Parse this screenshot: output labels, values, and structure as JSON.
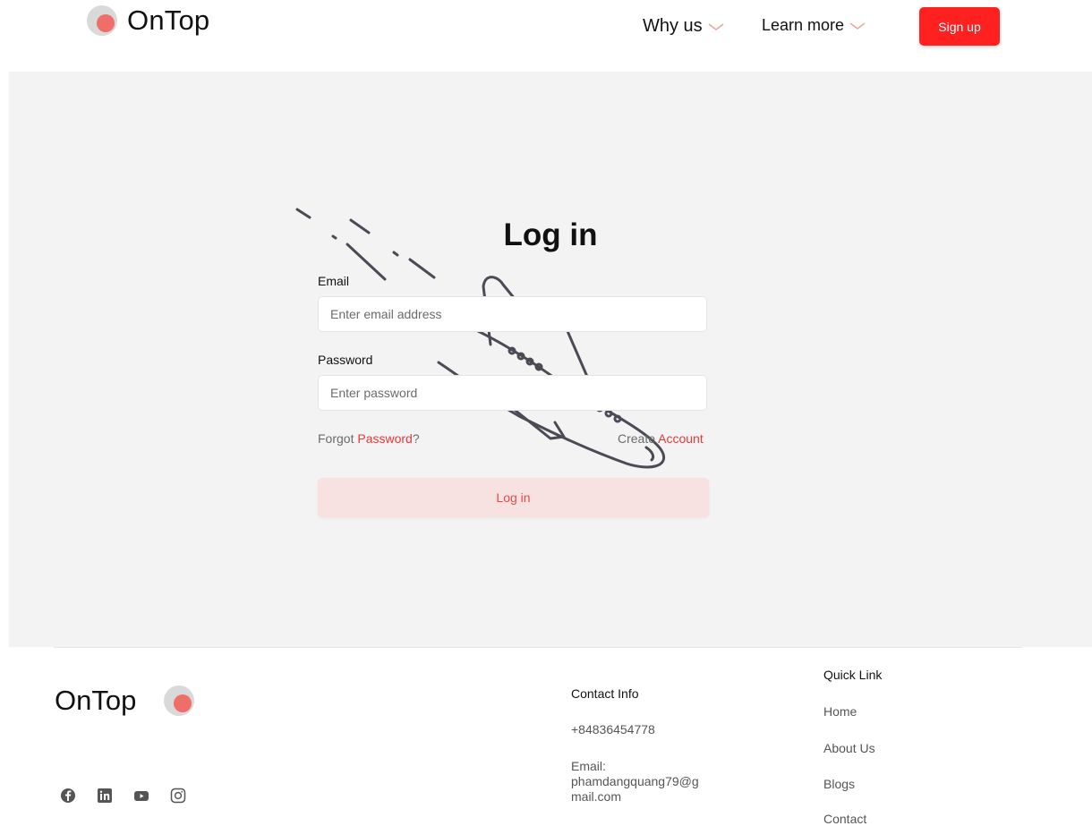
{
  "header": {
    "brand": "OnTop",
    "nav": [
      {
        "label": "Why us"
      },
      {
        "label": "Learn more"
      }
    ],
    "signup_label": "Sign up"
  },
  "login": {
    "title": "Log in",
    "email_label": "Email",
    "email_placeholder": "Enter email address",
    "password_label": "Password",
    "password_placeholder": "Enter password",
    "forgot_prefix": "Forgot ",
    "forgot_link": "Password",
    "forgot_suffix": "?",
    "create_prefix": "Create ",
    "create_link": "Account",
    "submit_label": "Log in"
  },
  "footer": {
    "brand": "OnTop",
    "social_icons": [
      "facebook-icon",
      "linkedin-icon",
      "youtube-icon",
      "instagram-icon"
    ],
    "contact": {
      "title": "Contact Info",
      "phone": "+84836454778",
      "email_label": "Email:",
      "email_line1": "phamdangquang79@g",
      "email_line2": "mail.com"
    },
    "quick_links": {
      "title": "Quick Link",
      "items": [
        "Home",
        "About Us",
        "Blogs",
        "Contact"
      ]
    }
  },
  "colors": {
    "accent": "#ff2020",
    "link_red": "#e8383a",
    "login_button_bg": "#f8e1e1",
    "logo_dot": "#ee6f6a",
    "main_bg": "#f3f3f3"
  }
}
